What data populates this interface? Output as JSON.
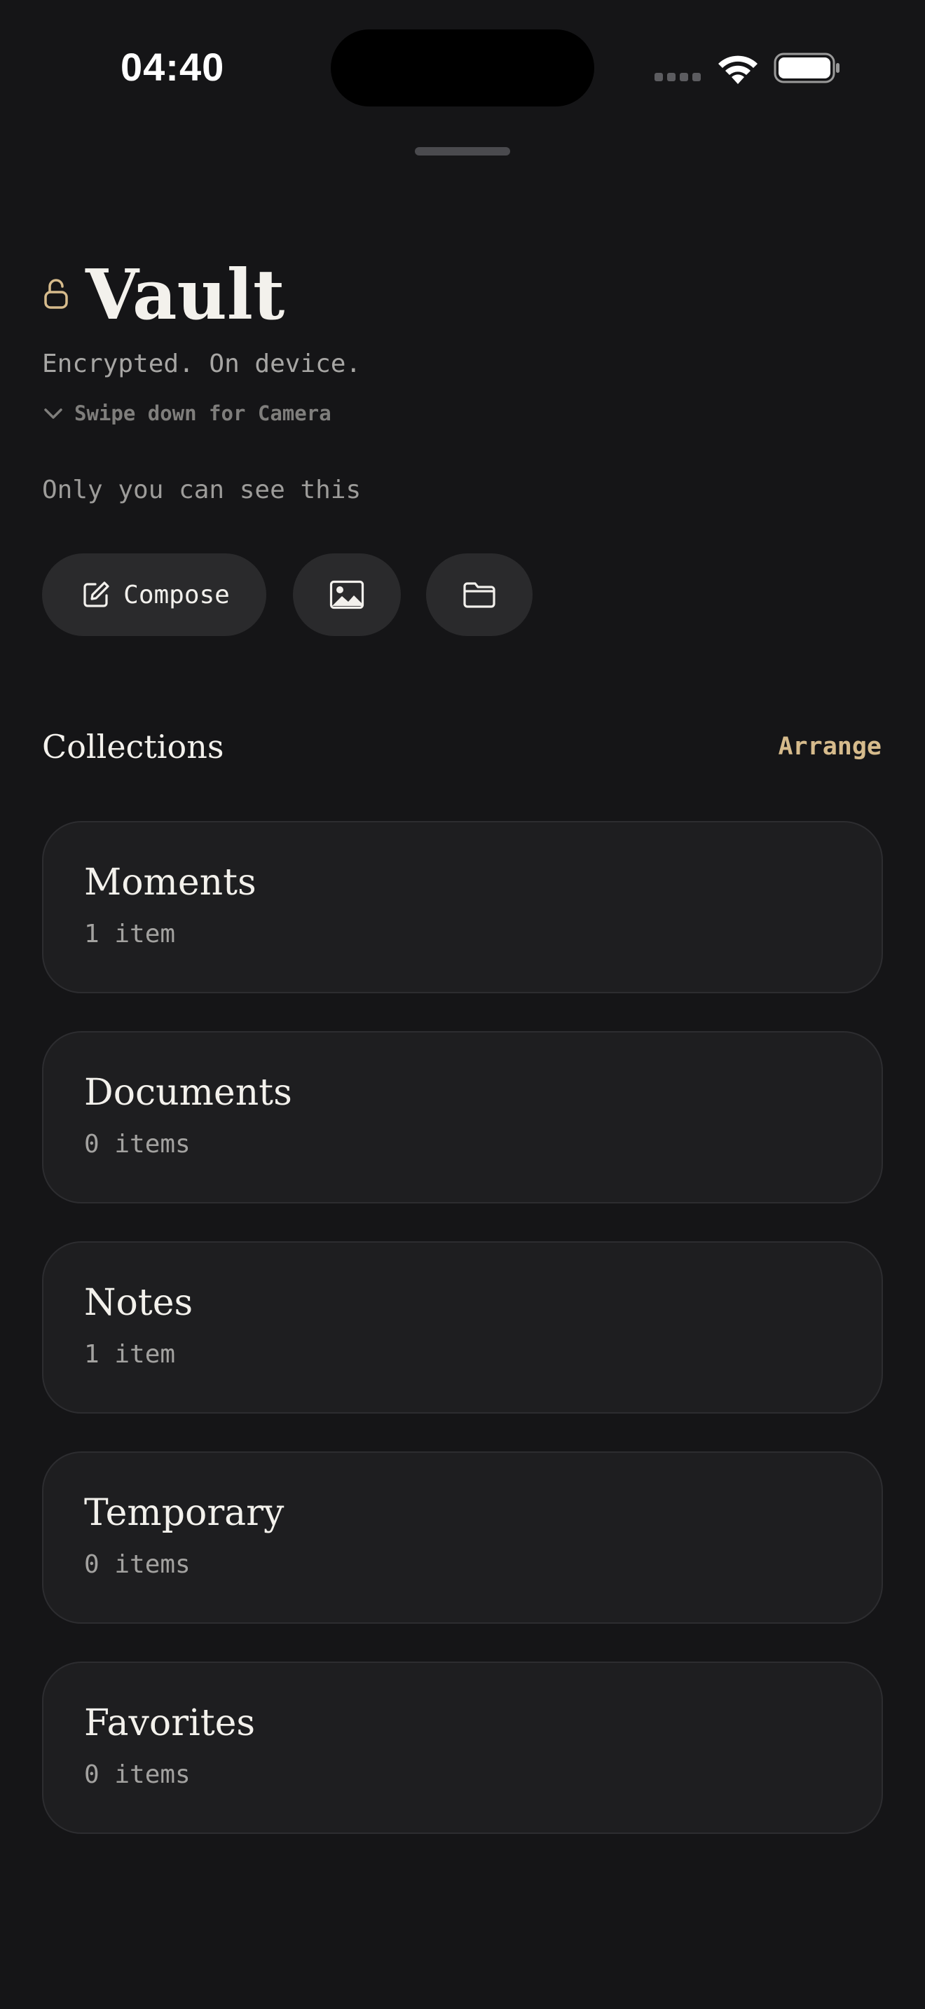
{
  "status_bar": {
    "time": "04:40",
    "icons": [
      "signal-icon",
      "wifi-icon",
      "battery-icon"
    ]
  },
  "header": {
    "icon": "lock-open-icon",
    "title": "Vault",
    "subtitle": "Encrypted. On device.",
    "swipe_hint": "Swipe down for Camera",
    "privacy_note": "Only you can see this"
  },
  "actions": {
    "compose_label": "Compose",
    "compose_icon": "compose-icon",
    "photo_icon": "image-icon",
    "folder_icon": "folder-icon"
  },
  "collections": {
    "title": "Collections",
    "arrange_label": "Arrange",
    "items": [
      {
        "name": "Moments",
        "count": "1 item"
      },
      {
        "name": "Documents",
        "count": "0 items"
      },
      {
        "name": "Notes",
        "count": "1 item"
      },
      {
        "name": "Temporary",
        "count": "0 items"
      },
      {
        "name": "Favorites",
        "count": "0 items"
      }
    ]
  },
  "colors": {
    "background": "#151517",
    "card": "#1e1e20",
    "accent": "#d6bb8c",
    "text_primary": "#f3f1ec",
    "text_secondary": "#a3a2a0"
  }
}
